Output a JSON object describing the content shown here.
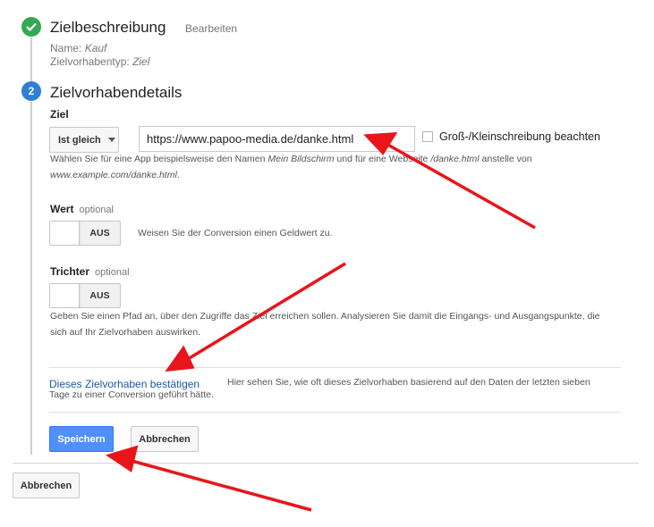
{
  "colors": {
    "check_green": "#34a853",
    "step_blue": "#2d7fd6",
    "primary": "#4d90fe",
    "link": "#1a5aa6",
    "arrow": "#e8151b"
  },
  "step1": {
    "title": "Zielbeschreibung",
    "edit_label": "Bearbeiten",
    "name_label": "Name:",
    "name_value": "Kauf",
    "type_label": "Zielvorhabentyp:",
    "type_value": "Ziel",
    "icon": "check-icon"
  },
  "step2": {
    "number": "2",
    "title": "Zielvorhabendetails"
  },
  "goal": {
    "label": "Ziel",
    "match_type": "Ist gleich",
    "url_value": "https://www.papoo-media.de/danke.html",
    "case_label": "Groß-/Kleinschreibung beachten",
    "help_a": "Wählen Sie für eine App beispielsweise den Namen ",
    "help_b": "Mein Bildschirm",
    "help_c": " und für eine Webseite ",
    "help_d": "/danke.html",
    "help_e": " anstelle von",
    "help_f": "www.example.com/danke.html",
    "help_g": "."
  },
  "value": {
    "label": "Wert",
    "optional": "optional",
    "toggle": "AUS",
    "help": "Weisen Sie der Conversion einen Geldwert zu."
  },
  "funnel": {
    "label": "Trichter",
    "optional": "optional",
    "toggle": "AUS",
    "help_1": "Geben Sie einen Pfad an, über den Zugriffe das Ziel erreichen sollen. Analysieren Sie damit die Eingangs- und Ausgangspunkte, die",
    "help_2": "sich auf Ihr Zielvorhaben auswirken."
  },
  "verify": {
    "link": "Dieses Zielvorhaben bestätigen",
    "desc_1": "Hier sehen Sie, wie oft dieses Zielvorhaben basierend auf den Daten der letzten sieben",
    "desc_2": "Tage zu einer Conversion geführt hätte."
  },
  "buttons": {
    "save": "Speichern",
    "cancel": "Abbrechen",
    "cancel_outer": "Abbrechen"
  }
}
